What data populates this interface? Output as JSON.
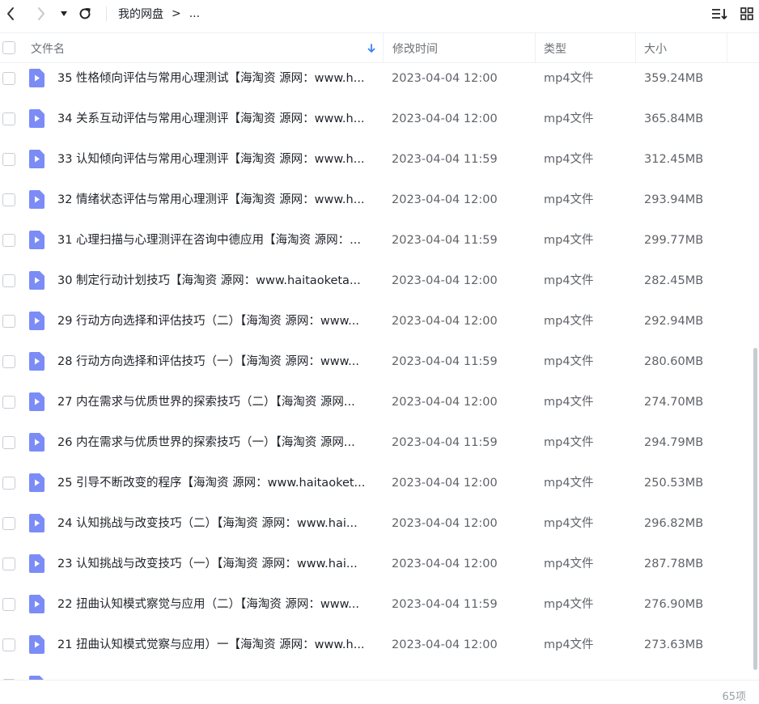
{
  "toolbar": {
    "back_icon": "chevron-left-icon",
    "forward_icon": "chevron-right-icon",
    "dropdown_icon": "caret-down-icon",
    "refresh_icon": "refresh-icon",
    "breadcrumb": {
      "root": "我的网盘",
      "separator": ">",
      "ellipsis": "..."
    },
    "sort_icon": "sort-list-icon",
    "view_icon": "grid-view-icon"
  },
  "columns": {
    "name": "文件名",
    "modified": "修改时间",
    "type": "类型",
    "size": "大小",
    "sort_indicator_icon": "arrow-down-icon",
    "sort_color": "#3b82f6"
  },
  "files": [
    {
      "name": "35 性格倾向评估与常用心理测试【海淘资 源网：www.h...",
      "modified": "2023-04-04 12:00",
      "type": "mp4文件",
      "size": "359.24MB"
    },
    {
      "name": "34 关系互动评估与常用心理测评【海淘资 源网：www.h...",
      "modified": "2023-04-04 12:00",
      "type": "mp4文件",
      "size": "365.84MB"
    },
    {
      "name": "33 认知倾向评估与常用心理测评【海淘资 源网：www.h...",
      "modified": "2023-04-04 11:59",
      "type": "mp4文件",
      "size": "312.45MB"
    },
    {
      "name": "32 情绪状态评估与常用心理测评【海淘资 源网：www.h...",
      "modified": "2023-04-04 12:00",
      "type": "mp4文件",
      "size": "293.94MB"
    },
    {
      "name": "31 心理扫描与心理测评在咨询中德应用【海淘资 源网：...",
      "modified": "2023-04-04 11:59",
      "type": "mp4文件",
      "size": "299.77MB"
    },
    {
      "name": "30 制定行动计划技巧【海淘资 源网：www.haitaoketa...",
      "modified": "2023-04-04 12:00",
      "type": "mp4文件",
      "size": "282.45MB"
    },
    {
      "name": "29 行动方向选择和评估技巧（二）【海淘资 源网：www...",
      "modified": "2023-04-04 12:00",
      "type": "mp4文件",
      "size": "292.94MB"
    },
    {
      "name": "28 行动方向选择和评估技巧（一）【海淘资 源网：www...",
      "modified": "2023-04-04 11:59",
      "type": "mp4文件",
      "size": "280.60MB"
    },
    {
      "name": "27 内在需求与优质世界的探索技巧（二）【海淘资 源网...",
      "modified": "2023-04-04 12:00",
      "type": "mp4文件",
      "size": "274.70MB"
    },
    {
      "name": "26 内在需求与优质世界的探索技巧（一）【海淘资 源网...",
      "modified": "2023-04-04 11:59",
      "type": "mp4文件",
      "size": "294.79MB"
    },
    {
      "name": "25 引导不断改变的程序【海淘资 源网：www.haitaoket...",
      "modified": "2023-04-04 12:00",
      "type": "mp4文件",
      "size": "250.53MB"
    },
    {
      "name": "24 认知挑战与改变技巧（二）【海淘资 源网：www.hai...",
      "modified": "2023-04-04 12:00",
      "type": "mp4文件",
      "size": "296.82MB"
    },
    {
      "name": "23 认知挑战与改变技巧（一）【海淘资 源网：www.hai...",
      "modified": "2023-04-04 12:00",
      "type": "mp4文件",
      "size": "287.78MB"
    },
    {
      "name": "22 扭曲认知模式察觉与应用（二）【海淘资 源网：www...",
      "modified": "2023-04-04 11:59",
      "type": "mp4文件",
      "size": "276.90MB"
    },
    {
      "name": "21 扭曲认知模式觉察与应用）一【海淘资 源网：www.h...",
      "modified": "2023-04-04 12:00",
      "type": "mp4文件",
      "size": "273.63MB"
    },
    {
      "name": "",
      "modified": "",
      "type": "",
      "size": ""
    }
  ],
  "file_icon": "video-file-icon",
  "file_icon_color": "#7b8cf7",
  "footer": {
    "count": "65项"
  }
}
